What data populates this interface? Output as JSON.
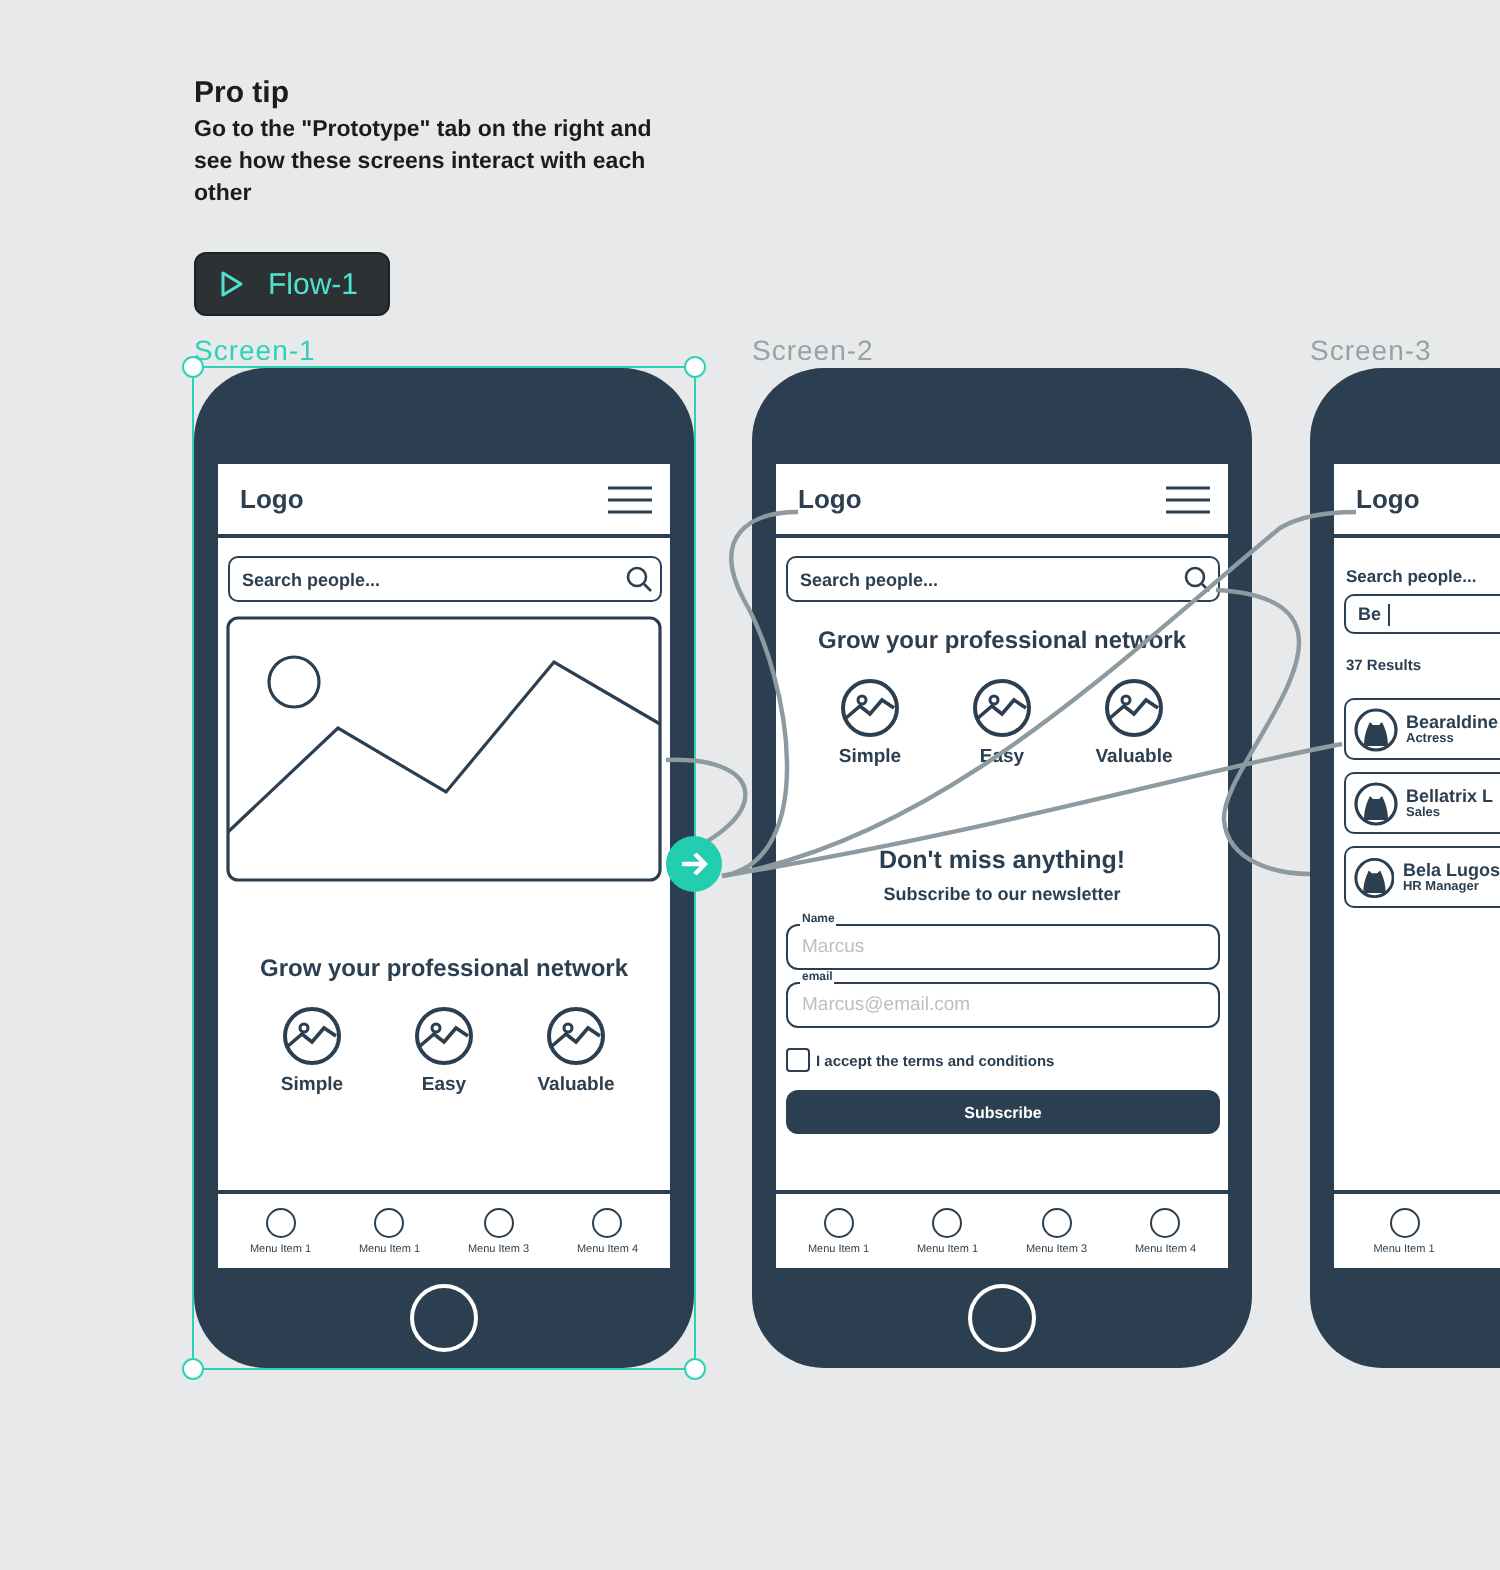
{
  "pro_tip": {
    "title": "Pro tip",
    "text": "Go to the \"Prototype\" tab on the right and see how these screens interact with each other"
  },
  "flow_button": {
    "label": "Flow-1"
  },
  "screens": [
    {
      "label": "Screen-1",
      "selected": true,
      "kind": "hero",
      "logo": "Logo",
      "search": {
        "placeholder": "Search people..."
      },
      "heading": "Grow your professional network",
      "features": [
        "Simple",
        "Easy",
        "Valuable"
      ],
      "menu": [
        "Menu Item 1",
        "Menu Item 1",
        "Menu Item 3",
        "Menu Item 4"
      ]
    },
    {
      "label": "Screen-2",
      "selected": false,
      "kind": "newsletter",
      "logo": "Logo",
      "search": {
        "placeholder": "Search people..."
      },
      "heading": "Grow your professional network",
      "features": [
        "Simple",
        "Easy",
        "Valuable"
      ],
      "newsletter": {
        "title": "Don't miss anything!",
        "subtitle": "Subscribe to our newsletter",
        "fields": [
          {
            "label": "Name",
            "placeholder": "Marcus"
          },
          {
            "label": "email",
            "placeholder": "Marcus@email.com"
          }
        ],
        "checkbox": {
          "label": "I accept the terms and conditions",
          "checked": false
        },
        "button": "Subscribe"
      },
      "menu": [
        "Menu Item 1",
        "Menu Item 1",
        "Menu Item 3",
        "Menu Item 4"
      ]
    },
    {
      "label": "Screen-3",
      "selected": false,
      "kind": "search",
      "logo": "Logo",
      "search_label": "Search people...",
      "search": {
        "value": "Be"
      },
      "results_count": "37 Results",
      "results": [
        {
          "name": "Bearaldine",
          "role": "Actress"
        },
        {
          "name": "Bellatrix L",
          "role": "Sales"
        },
        {
          "name": "Bela Lugos",
          "role": "HR Manager"
        }
      ],
      "menu": [
        "Menu Item 1"
      ]
    }
  ]
}
